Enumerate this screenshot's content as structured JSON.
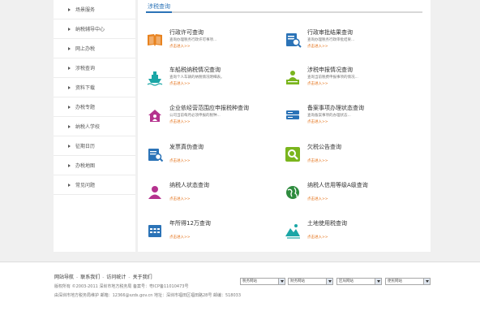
{
  "sidebar": {
    "items": [
      {
        "label": "场景服务"
      },
      {
        "label": "纳税辅导中心"
      },
      {
        "label": "网上办税"
      },
      {
        "label": "涉税查询"
      },
      {
        "label": "资料下载"
      },
      {
        "label": "办税专题"
      },
      {
        "label": "纳税人学校"
      },
      {
        "label": "征期日历"
      },
      {
        "label": "办税地图"
      },
      {
        "label": "常见问题"
      }
    ]
  },
  "main": {
    "tab_label": "涉税查询",
    "queries": [
      {
        "title": "行政许可查询",
        "desc": "查询办理税务行政许可事项...",
        "link": "点击进入>>",
        "icon": "book-icon",
        "color": "#e8821e"
      },
      {
        "title": "行政审批结果查询",
        "desc": "查询办理税务行政审批结果...",
        "link": "点击进入>>",
        "icon": "document-search-icon",
        "color": "#2b73b7"
      },
      {
        "title": "车船税纳税情况查询",
        "desc": "查询个人车辆的纳税情况明细表。",
        "link": "点击进入>>",
        "icon": "ship-icon",
        "color": "#1aa6a6"
      },
      {
        "title": "涉税申报情况查询",
        "desc": "查询当前税费申报事项的情况...",
        "link": "点击进入>>",
        "icon": "person-board-icon",
        "color": "#7ab51d"
      },
      {
        "title": "企业依经营范围应申报税种查询",
        "desc": "公司当前每月必须申报的税种...",
        "link": "点击进入>>",
        "icon": "house-person-icon",
        "color": "#b5328e"
      },
      {
        "title": "备案事项办理状态查询",
        "desc": "查询备案事项的办理状态...",
        "link": "点击进入>>",
        "icon": "database-icon",
        "color": "#2b73b7"
      },
      {
        "title": "发票真伪查询",
        "desc": "",
        "link": "点击进入>>",
        "icon": "invoice-search-icon",
        "color": "#2b73b7"
      },
      {
        "title": "欠税公告查询",
        "desc": "",
        "link": "点击进入>>",
        "icon": "search-icon",
        "color": "#7ab51d"
      },
      {
        "title": "纳税人状态查询",
        "desc": "",
        "link": "点击进入>>",
        "icon": "user-icon",
        "color": "#b5328e"
      },
      {
        "title": "纳税人信用等级A级查询",
        "desc": "",
        "link": "点击进入>>",
        "icon": "globe-icon",
        "color": "#2e8b3e"
      },
      {
        "title": "年所得12万查询",
        "desc": "",
        "link": "点击进入>>",
        "icon": "calendar-icon",
        "color": "#2b73b7"
      },
      {
        "title": "土地使用税查询",
        "desc": "",
        "link": "点击进入>>",
        "icon": "land-icon",
        "color": "#1aa6a6"
      }
    ]
  },
  "footer": {
    "nav": [
      "网站导航",
      "联系我们",
      "访问统计",
      "关于我们"
    ],
    "copyright": "版权所有 ©2003-2011 深圳市地方税务局 备案号：粤ICP备11010473号",
    "maintainer": "由深圳市地方税务局维护 邮箱：12366@szds.gov.cn 地址：深圳市福田区福田路28号 邮编：518033",
    "selects": [
      "税务网站",
      "财务网站",
      "区局网站",
      "便民网站"
    ]
  }
}
